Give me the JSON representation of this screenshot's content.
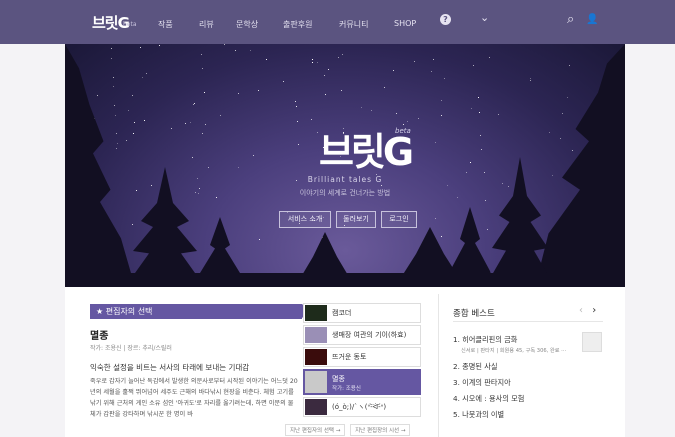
{
  "nav": {
    "logo": "브릿G",
    "beta": "beta",
    "items": [
      "작품",
      "리뷰",
      "문학상",
      "출판후원",
      "커뮤니티",
      "SHOP"
    ],
    "icons": [
      "help-icon",
      "chevron-down-icon",
      "search-icon",
      "user-icon"
    ],
    "help_glyph": "?",
    "chevron_glyph": "⌄",
    "search_glyph": "⌕",
    "user_glyph": "👤"
  },
  "hero": {
    "logo": "브릿G",
    "beta": "beta",
    "tagline": "Brilliant tales G",
    "subtitle": "이야기의 세계로 건너가는 방법",
    "buttons": [
      "서비스 소개",
      "둘러보기",
      "로그인"
    ]
  },
  "editor": {
    "badge_star": "★",
    "badge": "편집자의 선택",
    "title": "멸종",
    "meta": "작가: 조용신 | 장르: 추리/스릴러",
    "headline": "익숙한 설정을 비트는 서사의 타래에 보내는 기대감",
    "description": "죽우로 갑자기 늘어난 독감에서 발생한 의문사로부터 시작된 이야기는 어느덧 20년의 세월을 훌쩍 뛰어넘어 세주도 근해의 바다낚시 현장을 비춘다. 체험 고기를 낚기 위해 근처의 게인 소유 섬인 '아귀도'로 자리를 옮기려는데, 하면 이문의 물체가 갑판을 강타하며 낚시꾼 한 명이 바"
  },
  "thumbs": [
    {
      "title": "캠코더",
      "sub": ""
    },
    {
      "title": "생매장 여관의 기이(하효)",
      "sub": ""
    },
    {
      "title": "뜨거운 동토",
      "sub": ""
    },
    {
      "title": "멸종",
      "sub": "작가: 조용신"
    },
    {
      "title": "(ó_ò;)/`ヽ(ᐡ-᷅ᐛ-᷄ᐡ)",
      "sub": ""
    }
  ],
  "past_links": [
    "지난 편집자의 선택 →",
    "지난 편집장의 시선 →"
  ],
  "best": {
    "title": "종합 베스트",
    "prev": "‹",
    "next": "›",
    "items": [
      "1. 히어클리핀의 금화",
      "2. 종명된 사실",
      "3. 이계의 판타지아",
      "4. 시오에 : 용사의 모험",
      "5. 나뭇과의 이별"
    ],
    "first_sub": "신서로 | 판타지 | 회원용 45, 구독 306, 완료 ···"
  }
}
